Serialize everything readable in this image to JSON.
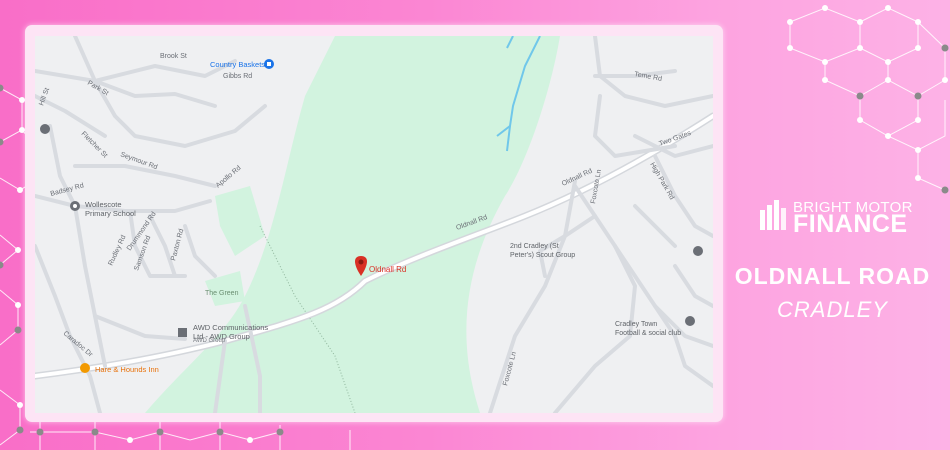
{
  "map": {
    "pin_label": "Oldnall Rd",
    "streets": [
      "Brook St",
      "Gibbs Rd",
      "Park St",
      "Hill St",
      "Fletcher St",
      "Seymour Rd",
      "Apollo Rd",
      "Badsey Rd",
      "Drummond Rd",
      "Rudley Rd",
      "Samson Rd",
      "Paxton Rd",
      "Caradoc Dr",
      "Oldnall Rd",
      "Foxcote Ln",
      "Teme Rd",
      "Two Gates",
      "High Park Rd"
    ],
    "pois": {
      "country_baskets": "Country Baskets",
      "school": "Wollescote\nPrimary School",
      "scout": "2nd Cradley (St\nPeter's) Scout Group",
      "football": "Cradley Town\nFootball & social club",
      "green": "The Green",
      "awd": "AWD Communications\nLtd - AWD Group",
      "awd_sub": "AWD Group",
      "pub": "Hare & Hounds Inn"
    },
    "colors": {
      "park": "#d2f3df",
      "road": "#ffffff",
      "road_casing": "#d4d7dc",
      "water": "#70c7ea",
      "pin": "#d93025"
    }
  },
  "brand": {
    "top": "BRIGHT MOTOR",
    "main": "FINANCE"
  },
  "location": {
    "title": "OLDNALL ROAD",
    "subtitle": "CRADLEY"
  }
}
